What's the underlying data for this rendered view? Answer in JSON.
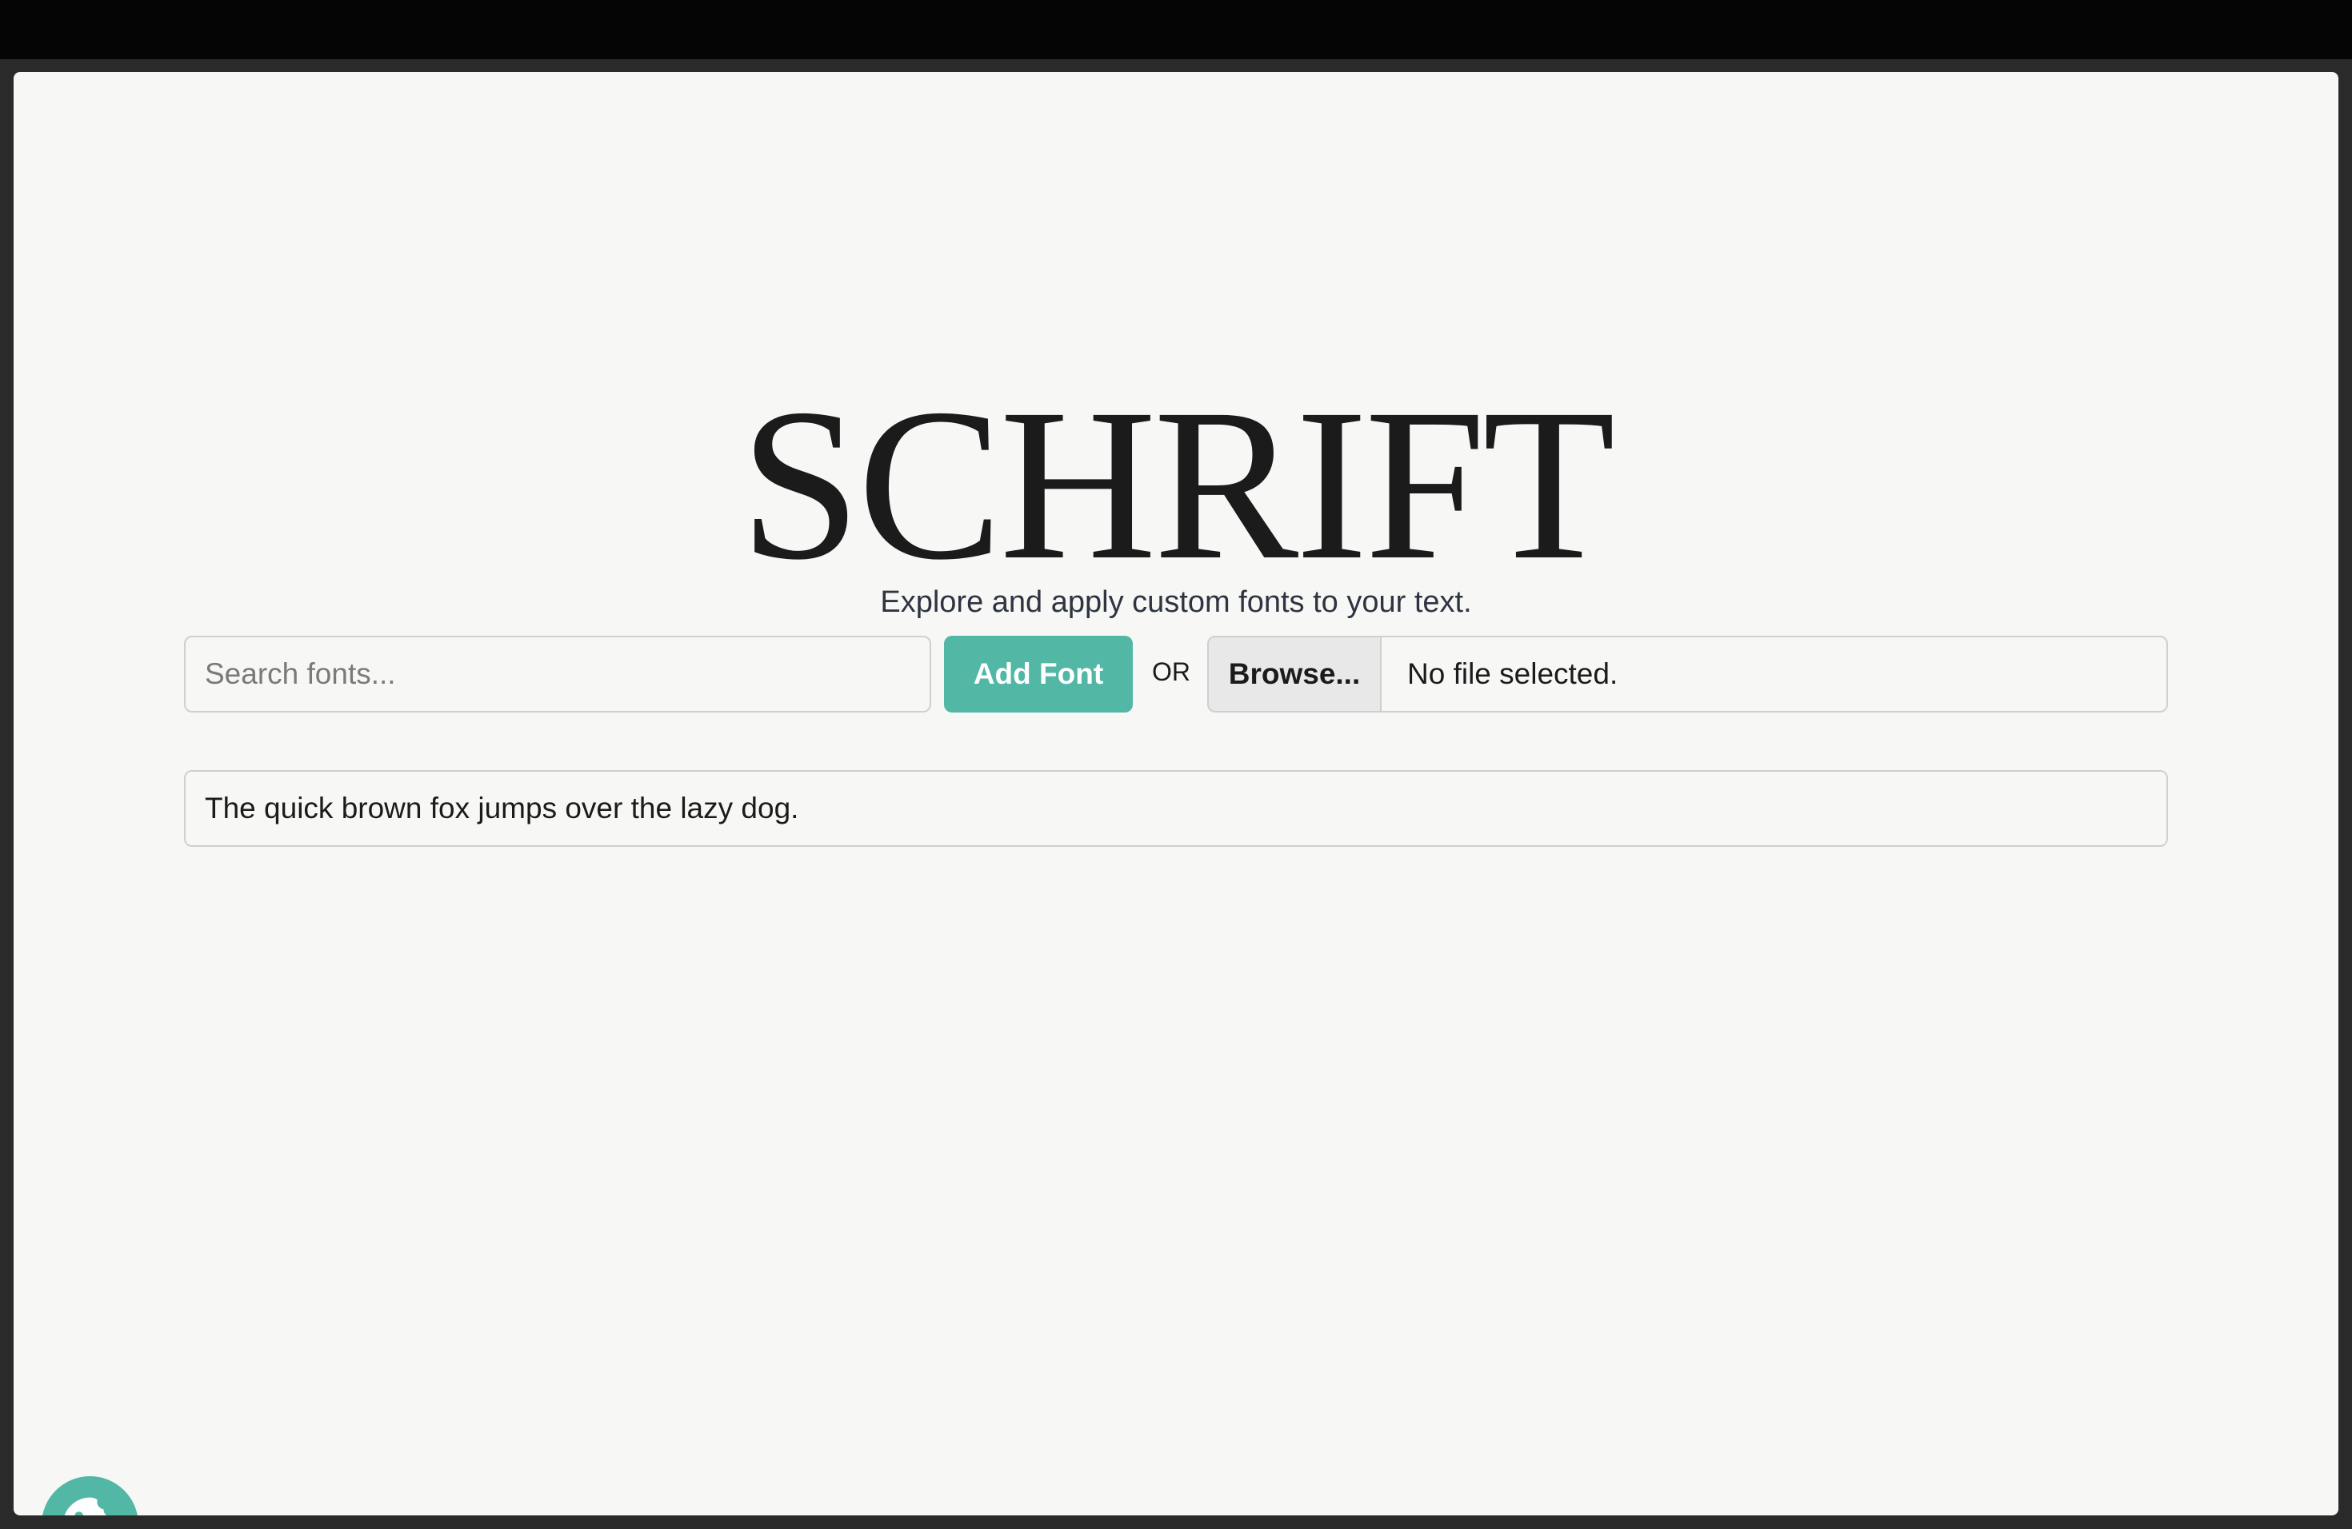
{
  "app": {
    "title": "SCHRIFT",
    "subtitle": "Explore and apply custom fonts to your text."
  },
  "controls": {
    "search_placeholder": "Search fonts...",
    "search_value": "",
    "add_button_label": "Add Font",
    "or_label": "OR",
    "browse_button_label": "Browse...",
    "file_status": "No file selected."
  },
  "preview": {
    "text": "The quick brown fox jumps over the lazy dog."
  },
  "cookie_button": {
    "icon": "cookie-icon"
  },
  "colors": {
    "accent": "#52b7a5",
    "background": "#f7f7f6",
    "text": "#1b1b1b"
  }
}
